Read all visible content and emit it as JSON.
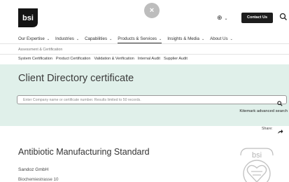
{
  "header": {
    "logo_text": "bsi",
    "close_symbol": "×",
    "globe_icon": "globe-icon",
    "contact_label": "Contact Us",
    "search_icon": "search-icon"
  },
  "primary_nav": [
    {
      "label": "Our Expertise",
      "active": false
    },
    {
      "label": "Industries",
      "active": false
    },
    {
      "label": "Capabilities",
      "active": false
    },
    {
      "label": "Products & Services",
      "active": true
    },
    {
      "label": "Insights & Media",
      "active": false
    },
    {
      "label": "About Us",
      "active": false
    }
  ],
  "breadcrumb": "Assessment & Certification",
  "sub_nav": [
    "System Certification",
    "Product Certification",
    "Validation & Verification",
    "Internal Audit",
    "Supplier Audit"
  ],
  "directory": {
    "title": "Client Directory certificate",
    "search_placeholder": "Enter Company name or certificate number. Results limited to 50 records.",
    "advanced_link": "Kitemark advanced search"
  },
  "share_label": "Share:",
  "certificate": {
    "title": "Antibiotic Manufacturing Standard",
    "company": "Sandoz GmbH",
    "address": "Biochemiestrasse 10"
  },
  "kitemark_text": "bsi",
  "colors": {
    "brand_dark": "#1d1d1d",
    "panel_bg": "#e0f0ea"
  }
}
